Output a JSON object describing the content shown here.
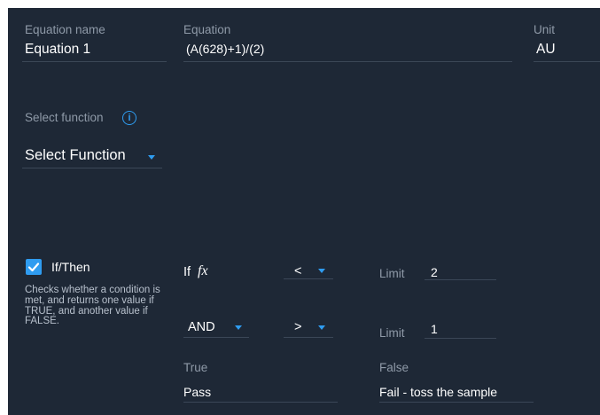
{
  "equation_name": {
    "label": "Equation name",
    "value": "Equation 1"
  },
  "equation": {
    "label": "Equation",
    "value": "(A(628)+1)/(2)"
  },
  "unit": {
    "label": "Unit",
    "value": "AU"
  },
  "select_function": {
    "label": "Select function",
    "info_icon": "info-icon",
    "dropdown_value": "Select Function"
  },
  "if_then": {
    "checked": true,
    "label": "If/Then",
    "description": "Checks whether a condition is met, and returns one value if TRUE, and another value if FALSE.",
    "row1": {
      "if_label": "If",
      "fx_label": "fx",
      "operator": "<",
      "limit_label": "Limit",
      "limit_value": "2"
    },
    "row2": {
      "logic": "AND",
      "operator": ">",
      "limit_label": "Limit",
      "limit_value": "1"
    },
    "true_label": "True",
    "true_value": "Pass",
    "false_label": "False",
    "false_value": "Fail - toss the sample"
  },
  "colors": {
    "panel_bg": "#1e2836",
    "accent": "#2f9cf0",
    "label": "#8f9aa8",
    "underline": "#3b4757"
  }
}
